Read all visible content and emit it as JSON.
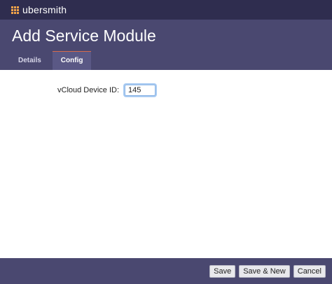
{
  "app": {
    "logo_text": "ubersmith"
  },
  "header": {
    "title": "Add Service Module",
    "tabs": [
      {
        "label": "Details",
        "active": false
      },
      {
        "label": "Config",
        "active": true
      }
    ]
  },
  "form": {
    "vcloud_device_id": {
      "label": "vCloud Device ID:",
      "value": "145"
    }
  },
  "footer": {
    "save_label": "Save",
    "save_new_label": "Save & New",
    "cancel_label": "Cancel"
  },
  "colors": {
    "topbar": "#2f2d4f",
    "header": "#4a4870",
    "accent": "#f0a24a",
    "tab_active": "#5a5885"
  }
}
